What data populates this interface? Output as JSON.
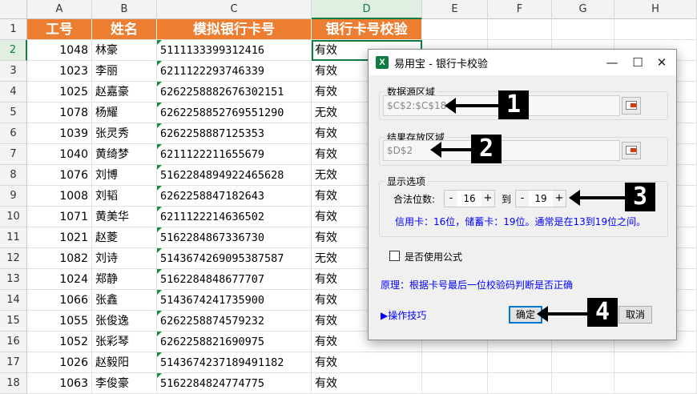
{
  "sheet": {
    "columns": [
      "A",
      "B",
      "C",
      "D",
      "E",
      "F",
      "G",
      "H"
    ],
    "selected_column": "D",
    "selected_row": "2",
    "header_row": {
      "row": "1",
      "cells": [
        "工号",
        "姓名",
        "模拟银行卡号",
        "银行卡号校验"
      ]
    },
    "rows": [
      {
        "row": "2",
        "id": "1048",
        "name": "林豪",
        "card": "5111133399312416",
        "result": "有效"
      },
      {
        "row": "3",
        "id": "1023",
        "name": "李丽",
        "card": "6211122293746339",
        "result": "有效"
      },
      {
        "row": "4",
        "id": "1025",
        "name": "赵嘉豪",
        "card": "6262258882676302151",
        "result": "有效"
      },
      {
        "row": "5",
        "id": "1078",
        "name": "杨耀",
        "card": "6262258852769551290",
        "result": "无效"
      },
      {
        "row": "6",
        "id": "1039",
        "name": "张灵秀",
        "card": "6262258887125353",
        "result": "有效"
      },
      {
        "row": "7",
        "id": "1040",
        "name": "黄绮梦",
        "card": "6211122211655679",
        "result": "有效"
      },
      {
        "row": "8",
        "id": "1076",
        "name": "刘博",
        "card": "5162284894922465628",
        "result": "无效"
      },
      {
        "row": "9",
        "id": "1008",
        "name": "刘韬",
        "card": "6262258847182643",
        "result": "有效"
      },
      {
        "row": "10",
        "id": "1071",
        "name": "黄美华",
        "card": "6211122214636502",
        "result": "有效"
      },
      {
        "row": "11",
        "id": "1021",
        "name": "赵菱",
        "card": "5162284867336730",
        "result": "有效"
      },
      {
        "row": "12",
        "id": "1082",
        "name": "刘诗",
        "card": "5143674269095387587",
        "result": "无效"
      },
      {
        "row": "13",
        "id": "1024",
        "name": "郑静",
        "card": "5162284848677707",
        "result": "有效"
      },
      {
        "row": "14",
        "id": "1066",
        "name": "张鑫",
        "card": "5143674241735900",
        "result": "有效"
      },
      {
        "row": "15",
        "id": "1055",
        "name": "张俊逸",
        "card": "6262258874579232",
        "result": "有效"
      },
      {
        "row": "16",
        "id": "1052",
        "name": "张彩琴",
        "card": "6262258821690975",
        "result": "有效"
      },
      {
        "row": "17",
        "id": "1026",
        "name": "赵毅阳",
        "card": "5143674237189491182",
        "result": "有效"
      },
      {
        "row": "18",
        "id": "1063",
        "name": "李俊豪",
        "card": "5162284824774775",
        "result": "有效"
      }
    ]
  },
  "dialog": {
    "title": "易用宝 - 银行卡校验",
    "app_icon": "excel-icon",
    "app_icon_letter": "X",
    "minimize": "—",
    "maximize": "☐",
    "close": "✕",
    "source_group": {
      "legend": "数据源区域",
      "value": "$C$2:$C$18"
    },
    "result_group": {
      "legend": "结果存放区域",
      "value": "$D$2"
    },
    "options_group": {
      "legend": "显示选项",
      "valid_digits_label": "合法位数:",
      "min_value": "16",
      "to_label": "到",
      "max_value": "19",
      "minus": "-",
      "plus": "+",
      "hint": "信用卡：16位，储蓄卡：19位。通常是在13到19位之间。"
    },
    "use_formula": {
      "label": "是否使用公式",
      "checked": false
    },
    "principle": "原理：根据卡号最后一位校验码判断是否正确",
    "tips_link": "▶操作技巧",
    "ok_label": "确定",
    "cancel_label": "取消"
  },
  "annotations": [
    "1",
    "2",
    "3",
    "4"
  ],
  "colors": {
    "header_fill": "#ed7d31",
    "excel_green": "#107c41",
    "link_blue": "#0000ff",
    "badge": "#000000"
  }
}
